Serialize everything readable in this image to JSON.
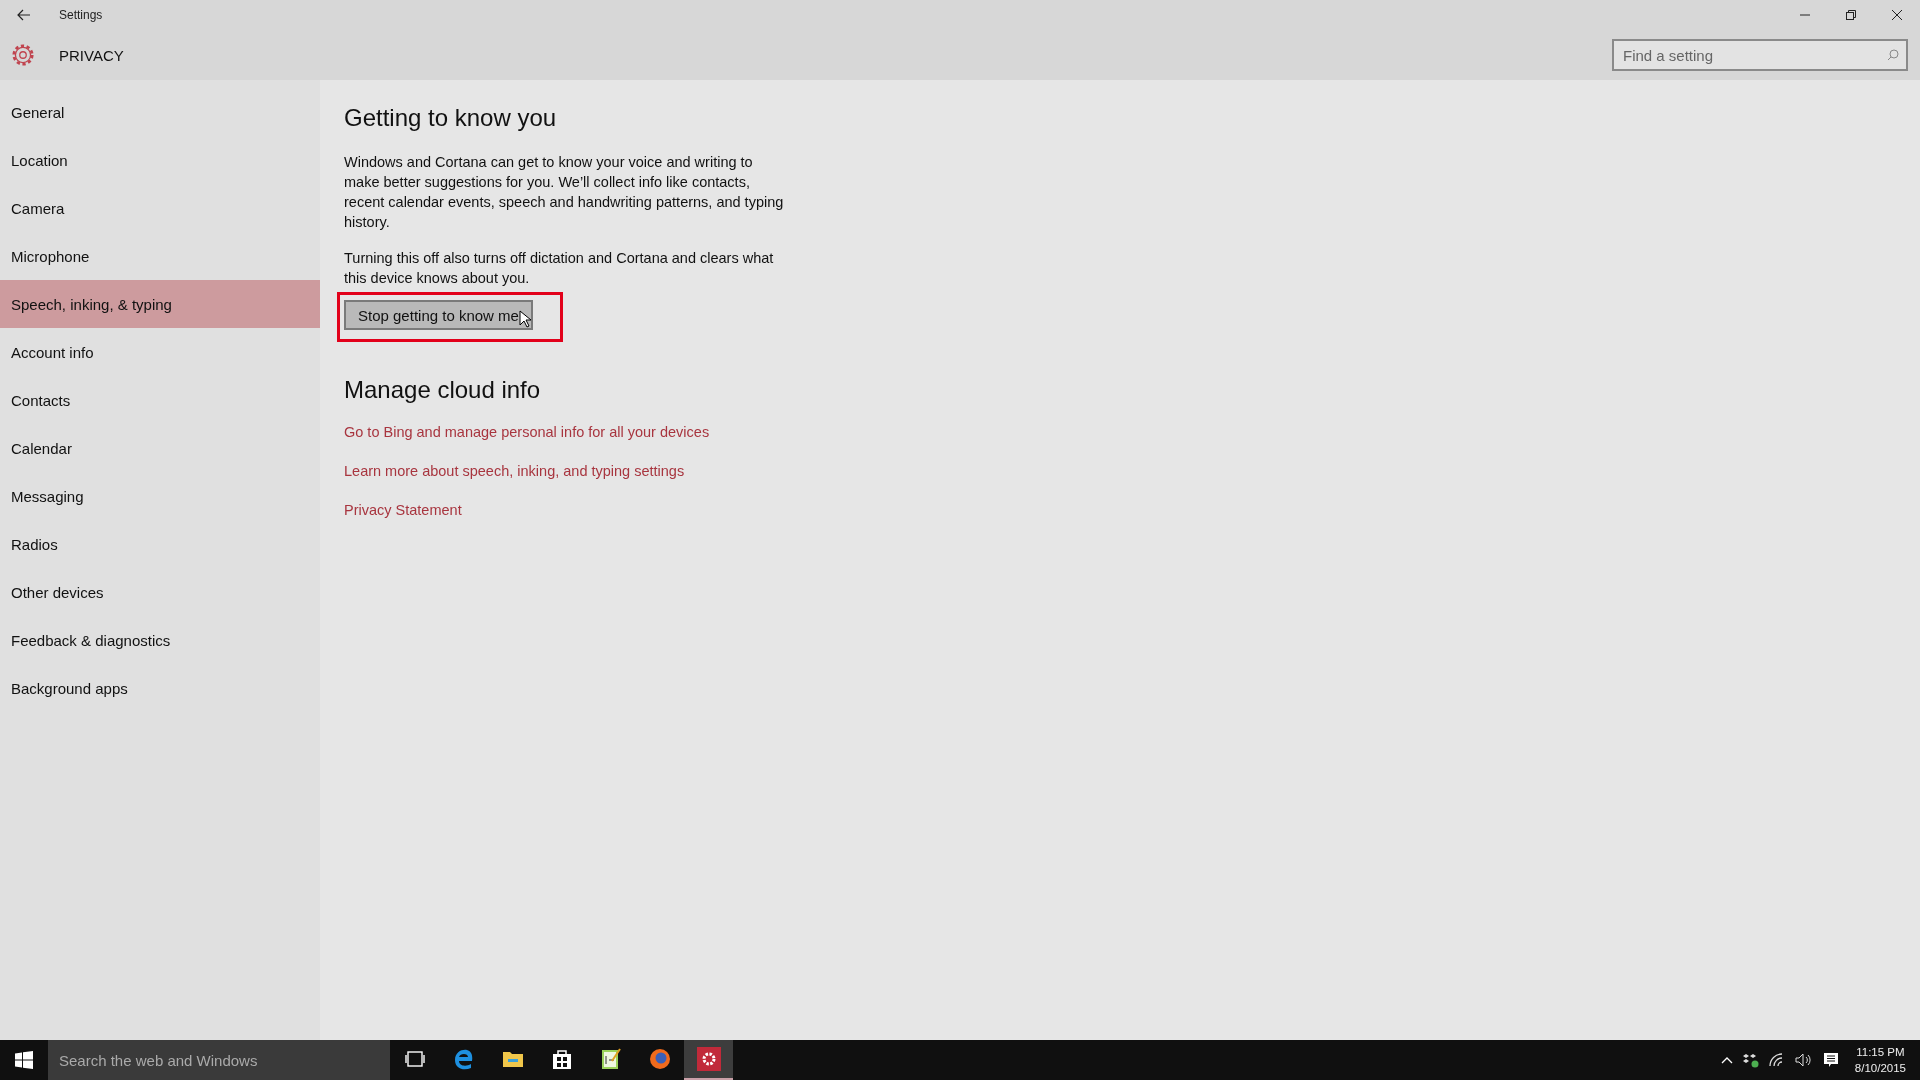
{
  "window": {
    "title": "Settings",
    "section": "PRIVACY"
  },
  "search": {
    "placeholder": "Find a setting"
  },
  "sidebar": {
    "items": [
      {
        "label": "General",
        "selected": false
      },
      {
        "label": "Location",
        "selected": false
      },
      {
        "label": "Camera",
        "selected": false
      },
      {
        "label": "Microphone",
        "selected": false
      },
      {
        "label": "Speech, inking, & typing",
        "selected": true
      },
      {
        "label": "Account info",
        "selected": false
      },
      {
        "label": "Contacts",
        "selected": false
      },
      {
        "label": "Calendar",
        "selected": false
      },
      {
        "label": "Messaging",
        "selected": false
      },
      {
        "label": "Radios",
        "selected": false
      },
      {
        "label": "Other devices",
        "selected": false
      },
      {
        "label": "Feedback & diagnostics",
        "selected": false
      },
      {
        "label": "Background apps",
        "selected": false
      }
    ]
  },
  "content": {
    "heading": "Getting to know you",
    "description": "Windows and Cortana can get to know your voice and writing to make better suggestions for you. We’ll collect info like contacts, recent calendar events, speech and handwriting patterns, and typing history.",
    "note": "Turning this off also turns off dictation and Cortana and clears what this device knows about you.",
    "button": "Stop getting to know me",
    "cloud_heading": "Manage cloud info",
    "links": [
      "Go to Bing and manage personal info for all your devices",
      "Learn more about speech, inking, and typing settings",
      "Privacy Statement"
    ]
  },
  "taskbar": {
    "search_placeholder": "Search the web and Windows",
    "apps": [
      {
        "kind": "taskview",
        "selected": false
      },
      {
        "kind": "edge",
        "selected": false
      },
      {
        "kind": "explorer",
        "selected": false
      },
      {
        "kind": "store",
        "selected": false
      },
      {
        "kind": "notepad",
        "selected": false
      },
      {
        "kind": "firefox",
        "selected": false
      },
      {
        "kind": "settings",
        "selected": true
      }
    ],
    "time": "11:15 PM",
    "date": "8/10/2015"
  }
}
